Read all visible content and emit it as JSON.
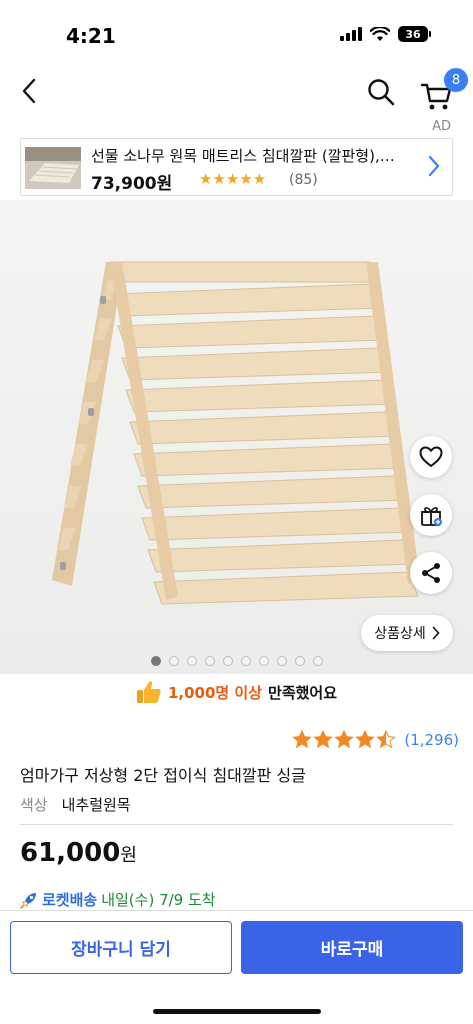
{
  "status_bar": {
    "time": "4:21",
    "battery": "36"
  },
  "nav": {
    "cart_count": "8",
    "ad_label": "AD"
  },
  "ad": {
    "title": "선물 소나무 원목 매트리스 침대깔판 (깔판형),…",
    "price": "73,900원",
    "stars": "★★★★★",
    "reviews": "(85)"
  },
  "image": {
    "total_slides": 10,
    "current_slide": 1
  },
  "actions": {
    "detail_label": "상품상세"
  },
  "satisfaction": {
    "highlight": "1,000명 이상",
    "text": "만족했어요"
  },
  "rating": {
    "stars_value": 4.5,
    "count": "(1,296)"
  },
  "product": {
    "title": "엄마가구 저상형 2단 접이식 침대깔판 싱글",
    "option_label": "색상",
    "option_value": "내추럴원목",
    "price": "61,000",
    "price_unit": "원"
  },
  "delivery": {
    "label": "로켓배송",
    "date": "내일(수) 7/9 도착"
  },
  "buttons": {
    "cart": "장바구니 담기",
    "buy": "바로구매"
  },
  "colors": {
    "accent": "#3a63e8",
    "badge": "#3a7ff6",
    "star": "#f08a24",
    "delivery_green": "#1d8a34"
  }
}
